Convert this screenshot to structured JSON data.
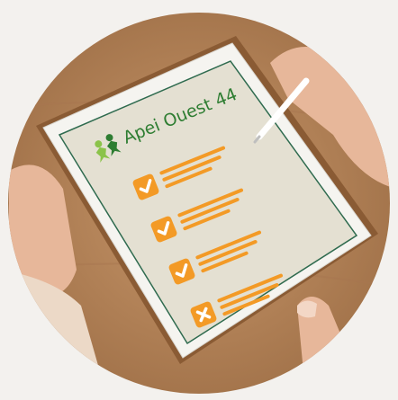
{
  "brand": {
    "name": "Apei Ouest 44"
  },
  "checklist": {
    "items": [
      {
        "state": "checked"
      },
      {
        "state": "checked"
      },
      {
        "state": "checked"
      },
      {
        "state": "crossed"
      }
    ]
  },
  "colors": {
    "background": "#f3f1ee",
    "wood": "#b8865a",
    "tablet_frame": "#f5f4f0",
    "screen": "#e4e0d2",
    "screen_border": "#2f6b4f",
    "accent_orange": "#f39a26",
    "brand_green": "#2e7d32",
    "brand_light_green": "#8bc34a",
    "skin": "#e7b79a"
  },
  "icons": {
    "logo": "people-logo-icon",
    "check": "checkmark-icon",
    "cross": "cross-icon",
    "stylus": "stylus-icon"
  }
}
